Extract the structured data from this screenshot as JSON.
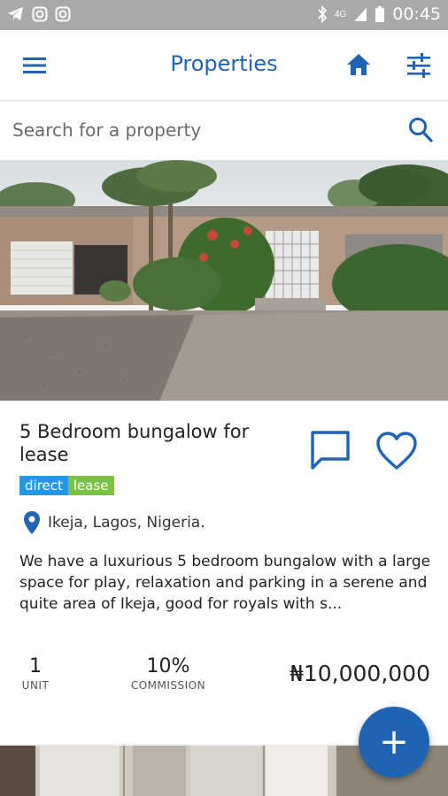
{
  "status_bar": {
    "time": "00:45",
    "network": "4G",
    "left_icons": [
      "telegram-icon",
      "instagram-icon",
      "instagram-icon"
    ],
    "right_icons": [
      "bluetooth-icon",
      "signal-icon",
      "battery-icon"
    ]
  },
  "app_bar": {
    "title": "Properties",
    "icons": [
      "menu-icon",
      "home-icon",
      "filter-icon"
    ]
  },
  "search": {
    "placeholder": "Search for a property",
    "icon": "search-icon"
  },
  "property": {
    "title": "5 Bedroom bungalow for lease",
    "tags": [
      "direct",
      "lease"
    ],
    "location": "Ikeja, Lagos, Nigeria.",
    "description": "We have a luxurious 5 bedroom bungalow with a large space for play, relaxation and parking in a serene and quite area of Ikeja, good for royals with s...",
    "unit_value": "1",
    "unit_label": "UNIT",
    "commission_value": "10%",
    "commission_label": "COMMISSION",
    "price": "₦10,000,000"
  },
  "fab": {
    "label": "+"
  },
  "colors": {
    "brand": "#1f63b4",
    "tag_direct": "#2199e8",
    "tag_lease": "#7cc242",
    "status_bar": "#a9a9a9"
  }
}
